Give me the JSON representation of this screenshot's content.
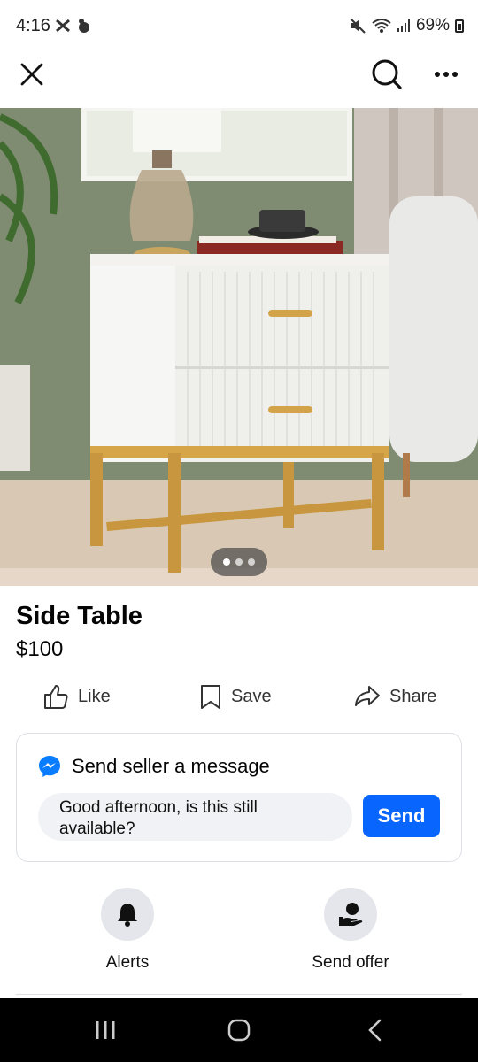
{
  "status_bar": {
    "time": "4:16",
    "battery_percent": "69%"
  },
  "product": {
    "title": "Side Table",
    "price": "$100",
    "image_count": 3,
    "active_image_index": 0
  },
  "actions": {
    "like_label": "Like",
    "save_label": "Save",
    "share_label": "Share"
  },
  "message": {
    "header": "Send seller a message",
    "input_value": "Good afternoon, is this still available?",
    "send_label": "Send"
  },
  "quick_actions": {
    "alerts_label": "Alerts",
    "send_offer_label": "Send offer"
  },
  "colors": {
    "accent": "#0866ff",
    "messenger_blue": "#0a7cff"
  }
}
